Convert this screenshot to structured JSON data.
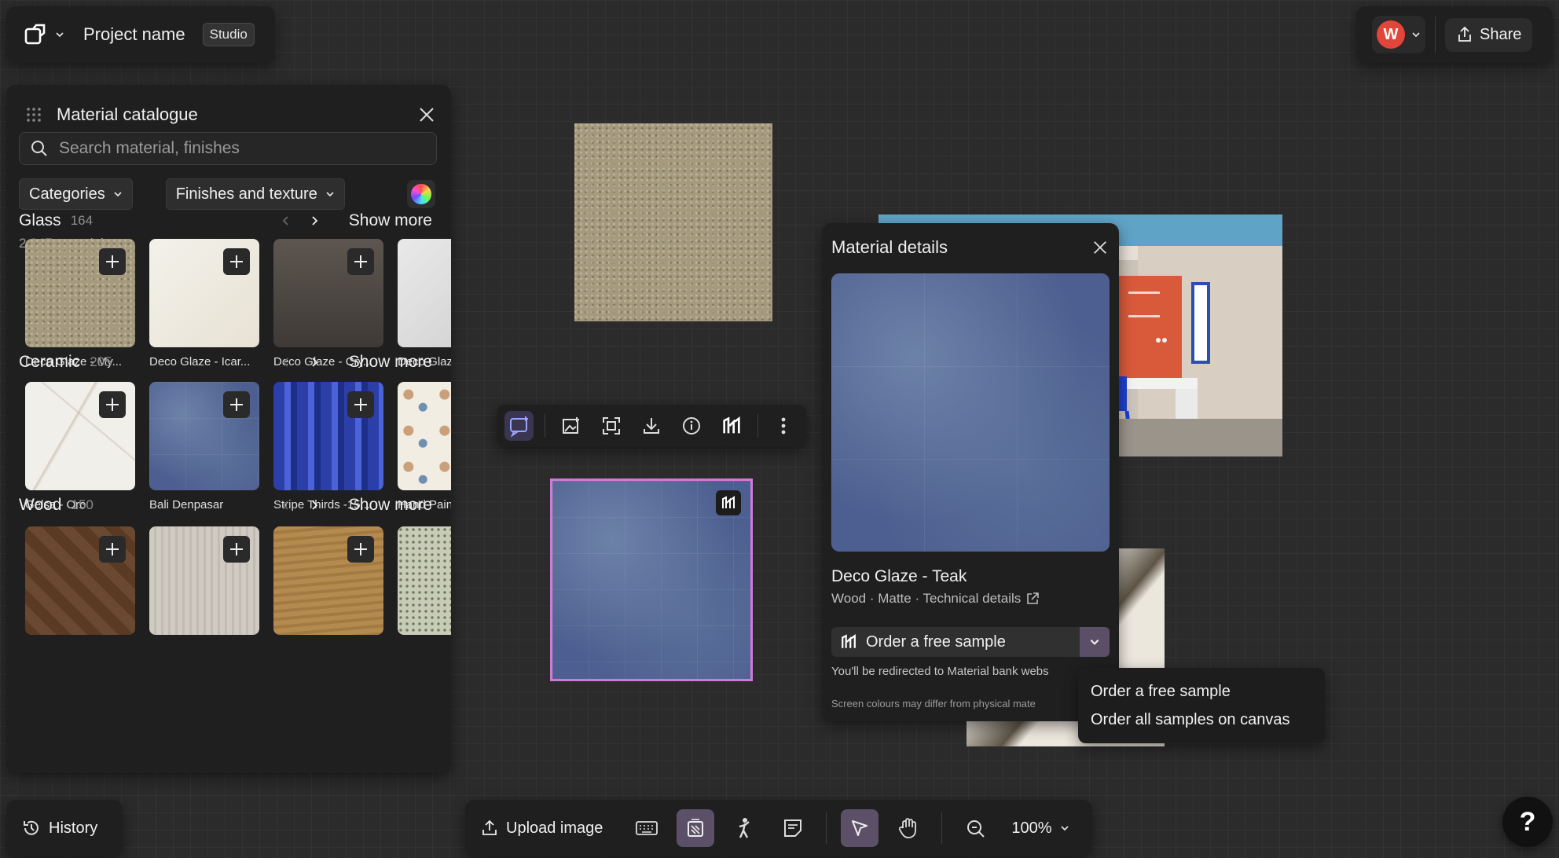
{
  "topbar": {
    "project_name": "Project name",
    "badge": "Studio"
  },
  "topright": {
    "avatar_initial": "W",
    "share_label": "Share"
  },
  "catalogue": {
    "title": "Material catalogue",
    "search_placeholder": "Search material, finishes",
    "filter_categories": "Categories",
    "filter_finishes": "Finishes and texture",
    "count": "2,847 materials",
    "show_more": "Show more",
    "sections": [
      {
        "name": "Glass",
        "count": "164",
        "items": [
          "Deco Glaze - My...",
          "Deco Glaze - Icar...",
          "Deco Glaze - Cry...",
          "Deco Glaz"
        ]
      },
      {
        "name": "Ceramic",
        "count": "205",
        "items": [
          "Gelsa - Oro",
          "Bali Denpasar",
          "Stripe Thirds -15...",
          "Hand Pain"
        ]
      },
      {
        "name": "Wood",
        "count": "150",
        "items": [
          "",
          "",
          "",
          ""
        ]
      }
    ]
  },
  "details": {
    "title": "Material details",
    "material_name": "Deco Glaze - Teak",
    "meta": "Wood · Matte · Technical details",
    "order_label": "Order a free sample",
    "note": "You'll be redirected to Material bank webs",
    "note2": "Screen colours may differ from physical mate"
  },
  "order_menu": {
    "items": [
      "Order a free sample",
      "Order all samples on canvas"
    ]
  },
  "history": {
    "label": "History"
  },
  "bottom_toolbar": {
    "upload_label": "Upload image",
    "zoom": "100%"
  },
  "help": {
    "label": "?"
  }
}
